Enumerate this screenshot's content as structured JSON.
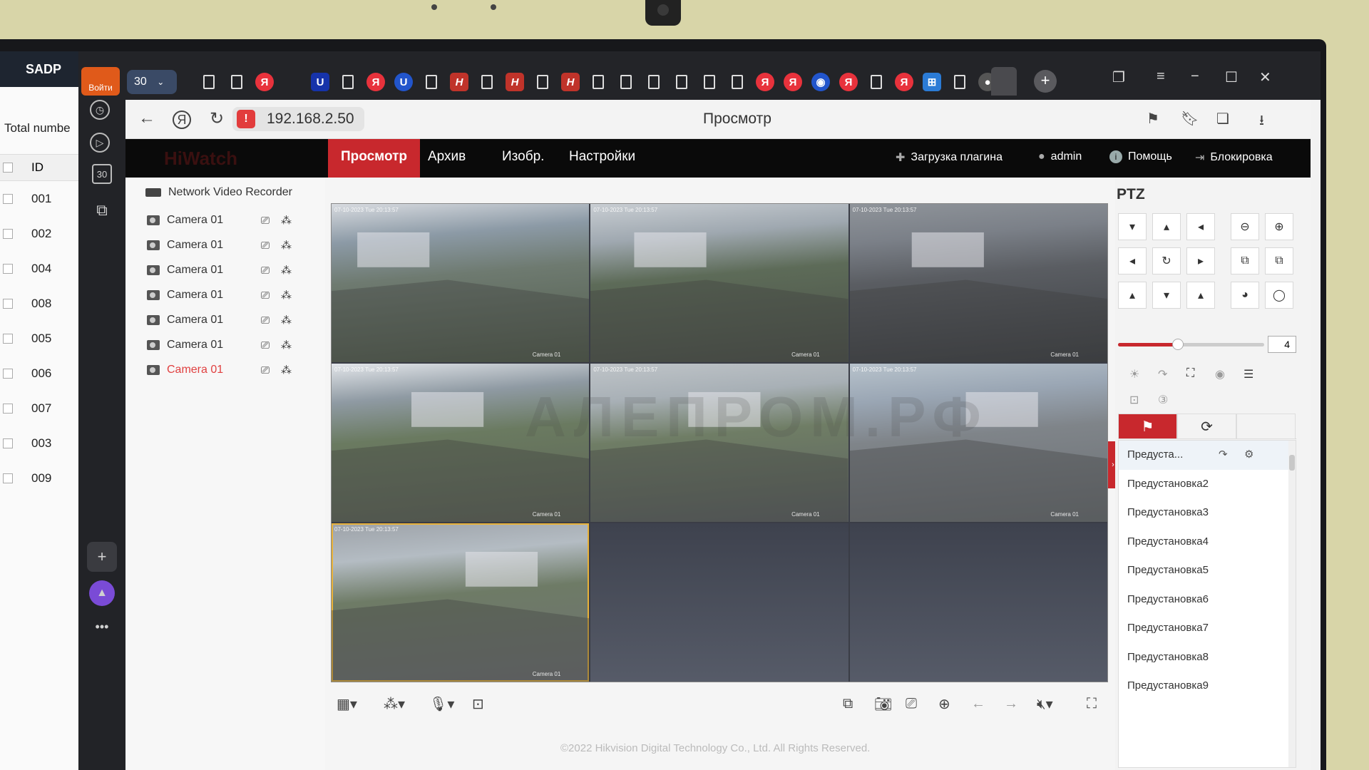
{
  "sadp": {
    "title": "SADP",
    "total_label": "Total numbe",
    "id_header": "ID",
    "ids": [
      "001",
      "002",
      "004",
      "008",
      "005",
      "006",
      "007",
      "003",
      "009"
    ]
  },
  "browser": {
    "login_label": "Войти",
    "tab_count": "30",
    "url": "192.168.2.50",
    "page_title": "Просмотр",
    "rail_badge": "30"
  },
  "nav": {
    "logo": "HiWatch",
    "items": [
      "Просмотр",
      "Архив",
      "Изобр.",
      "Настройки"
    ],
    "plugin": "Загрузка плагина",
    "user": "admin",
    "help": "Помощь",
    "lock": "Блокировка"
  },
  "camera_panel": {
    "device": "Network Video Recorder",
    "cameras": [
      "Camera 01",
      "Camera 01",
      "Camera 01",
      "Camera 01",
      "Camera 01",
      "Camera 01",
      "Camera 01"
    ]
  },
  "video": {
    "timestamp": "07-10-2023 Tue 20:13:57",
    "cam_label": "Camera 01",
    "watermark": "АЛЕПРОМ.РФ"
  },
  "ptz": {
    "title": "PTZ",
    "speed": "4",
    "speed_fraction": 0.41,
    "presets": [
      "Предуста...",
      "Предустановка2",
      "Предустановка3",
      "Предустановка4",
      "Предустановка5",
      "Предустановка6",
      "Предустановка7",
      "Предустановка8",
      "Предустановка9"
    ]
  },
  "footer": {
    "copyright": "©2022 Hikvision Digital Technology Co., Ltd. All Rights Reserved."
  },
  "colors": {
    "accent": "#c8282d",
    "nav_bg": "#0a0a0a",
    "selected_camera": "#e04040"
  }
}
